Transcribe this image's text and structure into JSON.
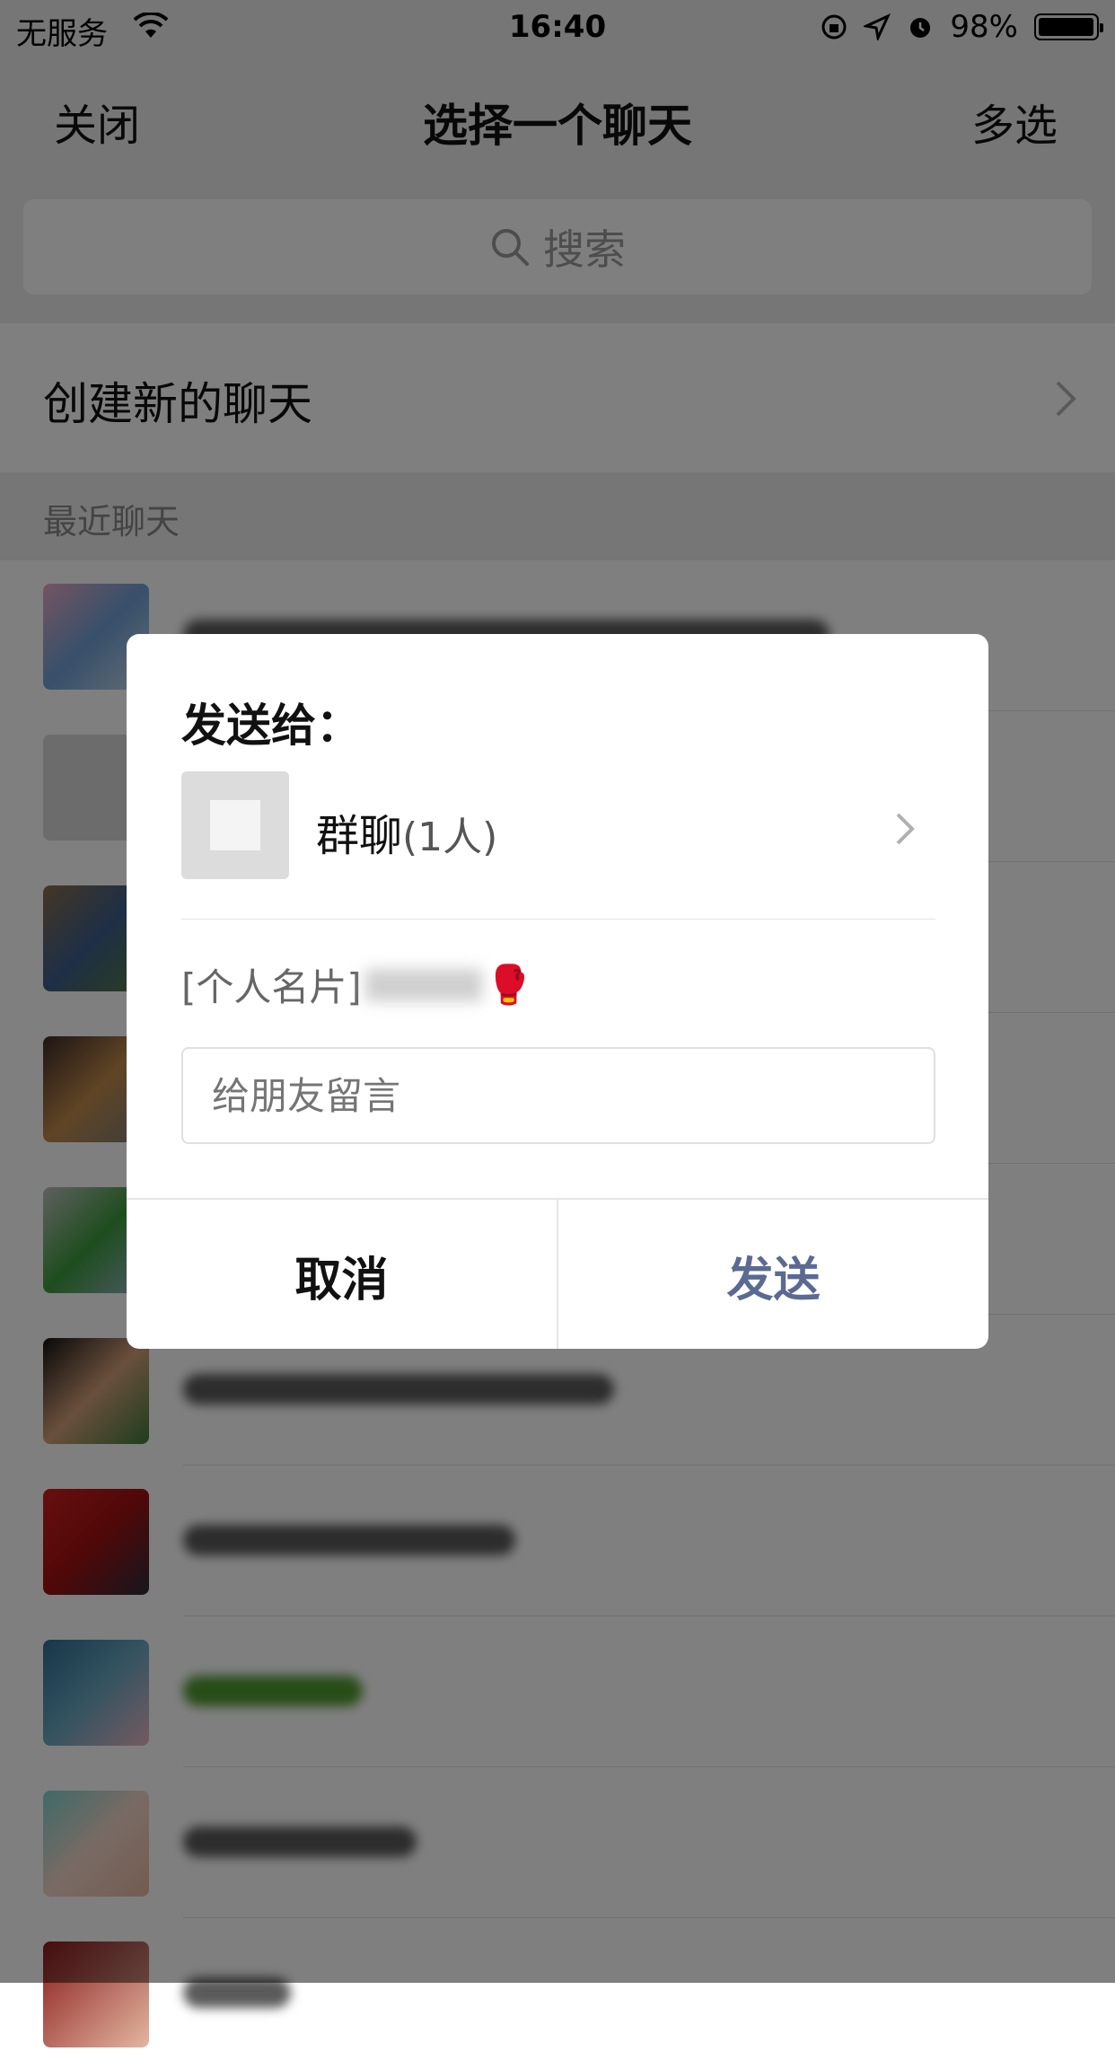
{
  "status_bar": {
    "carrier": "无服务",
    "time": "16:40",
    "battery": "98%"
  },
  "nav": {
    "left": "关闭",
    "title": "选择一个聊天",
    "right": "多选"
  },
  "search": {
    "placeholder": "搜索"
  },
  "new_chat": {
    "label": "创建新的聊天"
  },
  "section": {
    "title": "最近聊天"
  },
  "dialog": {
    "title": "发送给：",
    "target_name": "群聊",
    "target_count": "(1人)",
    "card_prefix": "[个人名片]",
    "card_emoji": "🥊",
    "message_placeholder": "给朋友留言",
    "cancel_label": "取消",
    "send_label": "发送"
  },
  "colors": {
    "send_text": "#5b6a92",
    "overlay": "rgba(0,0,0,0.5)"
  }
}
